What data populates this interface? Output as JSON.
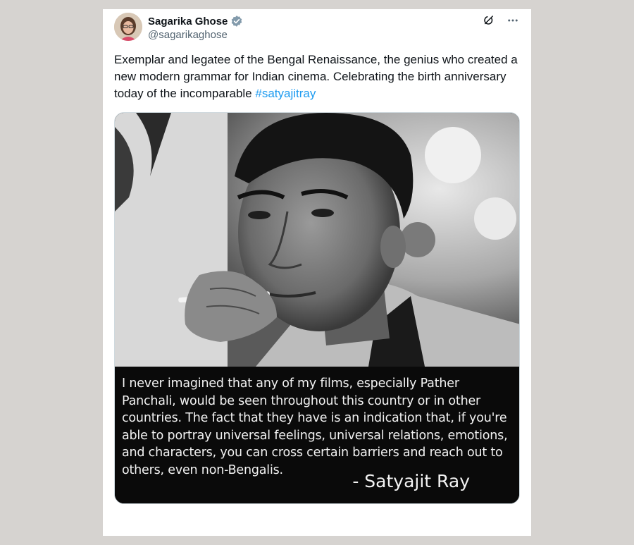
{
  "tweet": {
    "author_name": "Sagarika Ghose",
    "author_handle": "@sagarikaghose",
    "verified": true,
    "text_before_hashtag": "Exemplar and legatee of the Bengal Renaissance, the genius who created a new modern grammar for Indian cinema. Celebrating the birth anniversary today of the incomparable ",
    "hashtag": "#satyajitray",
    "hashtag_color": "#1d9bf0",
    "verified_color": "#829aab"
  },
  "icons": {
    "grok": "grok-icon",
    "more": "more-options-icon",
    "verified": "verified-badge-icon"
  },
  "media": {
    "quote": "I never imagined that any of my films, especially Pather Panchali, would be seen throughout this country or in other countries. The fact that they have is an indication that, if you're able to portray universal feelings, universal relations, emotions, and characters, you can cross certain barriers and reach out to others, even non-Bengalis.",
    "attribution": "- Satyajit Ray"
  }
}
